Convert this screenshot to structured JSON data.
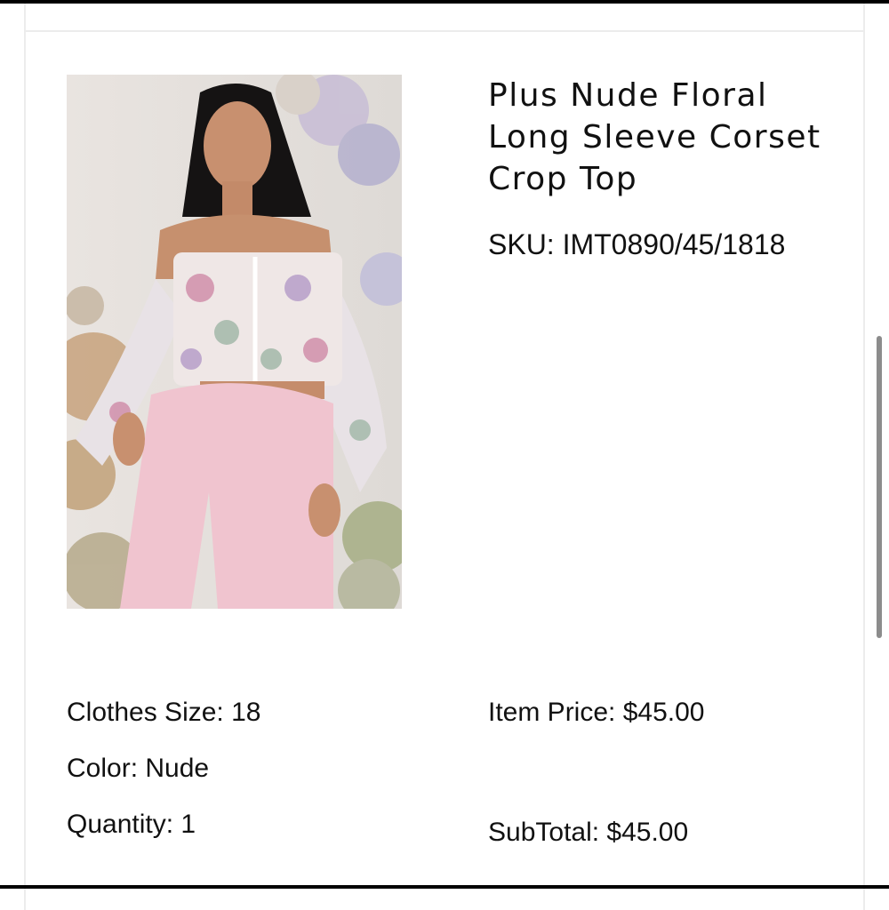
{
  "product": {
    "title": "Plus Nude Floral Long Sleeve Corset Crop Top",
    "sku": "SKU: IMT0890/45/1818",
    "image_alt": "Model wearing floral corset crop top with pink trousers"
  },
  "details": {
    "clothes_size": "Clothes Size: 18",
    "color": "Color: Nude",
    "quantity": "Quantity: 1",
    "item_price": "Item Price: $45.00",
    "subtotal": "SubTotal: $45.00"
  },
  "colors": {
    "background": "#ffffff",
    "text": "#111111",
    "scrollbar": "#8c8c8c",
    "card_border": "#ececec"
  }
}
